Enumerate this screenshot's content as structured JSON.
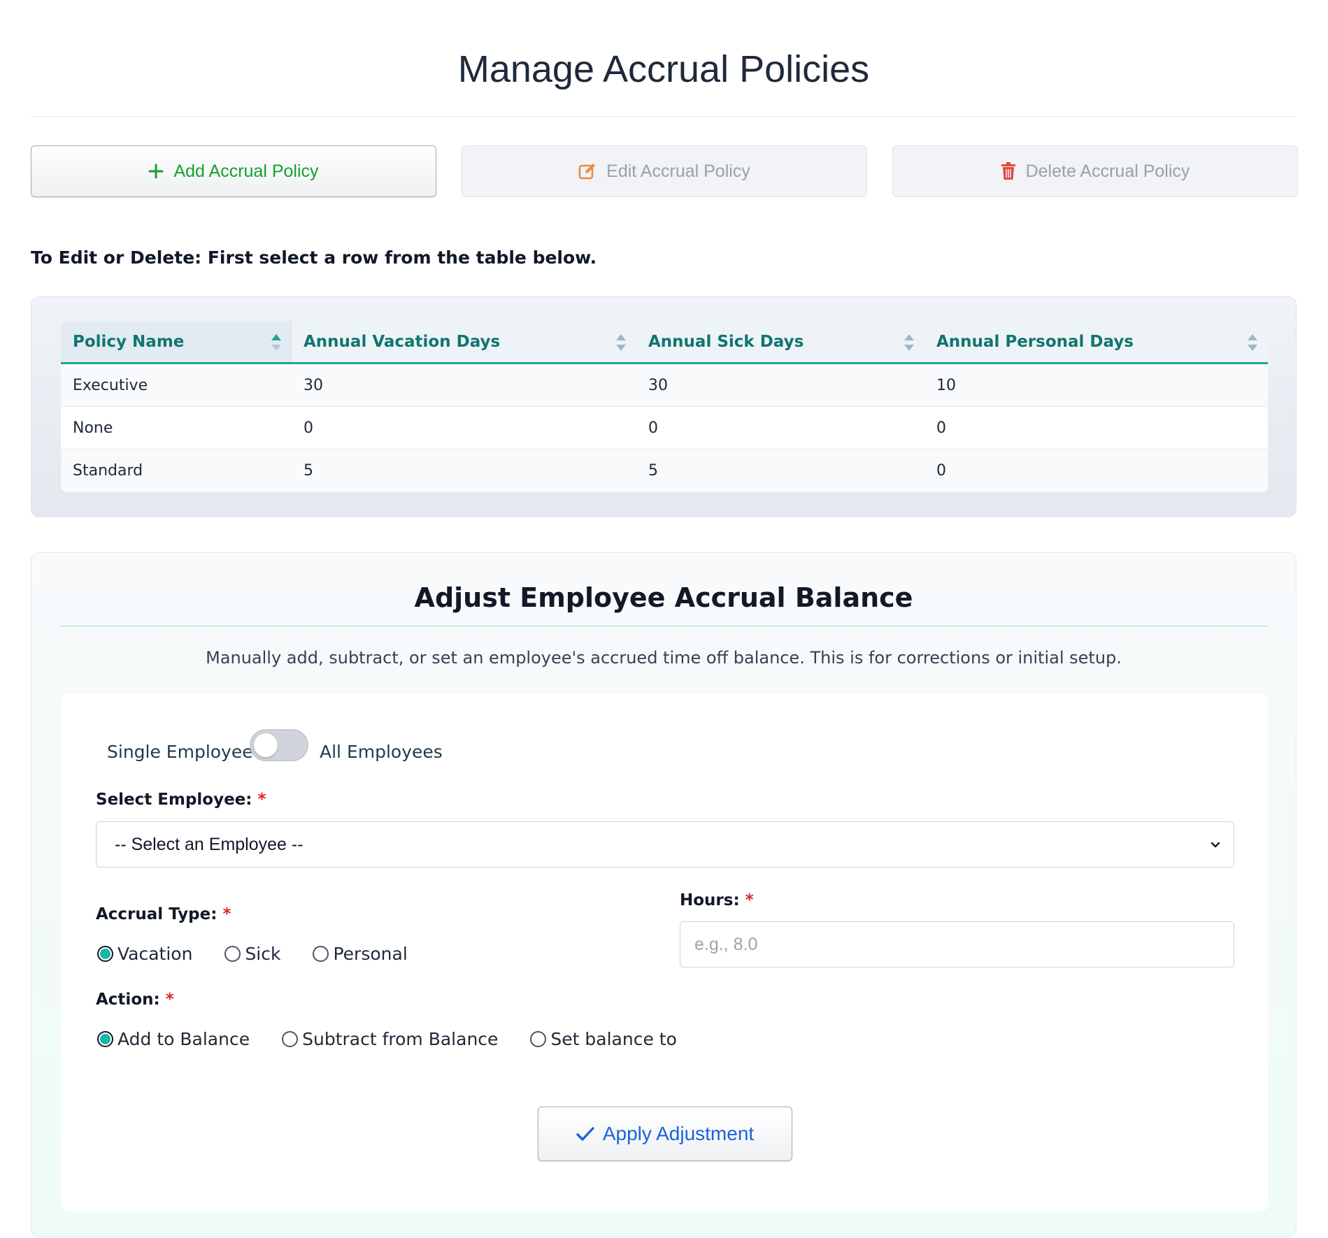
{
  "page": {
    "title": "Manage Accrual Policies"
  },
  "toolbar": {
    "add_label": "Add Accrual Policy",
    "edit_label": "Edit Accrual Policy",
    "delete_label": "Delete Accrual Policy"
  },
  "hint": "To Edit or Delete: First select a row from the table below.",
  "table": {
    "columns": [
      "Policy Name",
      "Annual Vacation Days",
      "Annual Sick Days",
      "Annual Personal Days"
    ],
    "rows": [
      [
        "Executive",
        "30",
        "30",
        "10"
      ],
      [
        "None",
        "0",
        "0",
        "0"
      ],
      [
        "Standard",
        "5",
        "5",
        "0"
      ]
    ]
  },
  "adjust": {
    "title": "Adjust Employee Accrual Balance",
    "description": "Manually add, subtract, or set an employee's accrued time off balance. This is for corrections or initial setup.",
    "mode_left": "Single Employee",
    "mode_right": "All Employees",
    "mode_all_employees_on": false,
    "employee_label": "Select Employee:",
    "employee_value": "-- Select an Employee --",
    "accrual_type_label": "Accrual Type:",
    "accrual_types": [
      "Vacation",
      "Sick",
      "Personal"
    ],
    "accrual_type_selected": "Vacation",
    "hours_label": "Hours:",
    "hours_placeholder": "e.g., 8.0",
    "action_label": "Action:",
    "actions": [
      "Add to Balance",
      "Subtract from Balance",
      "Set balance to"
    ],
    "action_selected": "Add to Balance",
    "apply_label": "Apply Adjustment",
    "required_mark": "*"
  },
  "colors": {
    "accent": "#14b8a6",
    "header_text": "#0f766e",
    "add_green": "#17a02a",
    "apply_blue": "#1d63d8",
    "required_red": "#dc2626"
  }
}
